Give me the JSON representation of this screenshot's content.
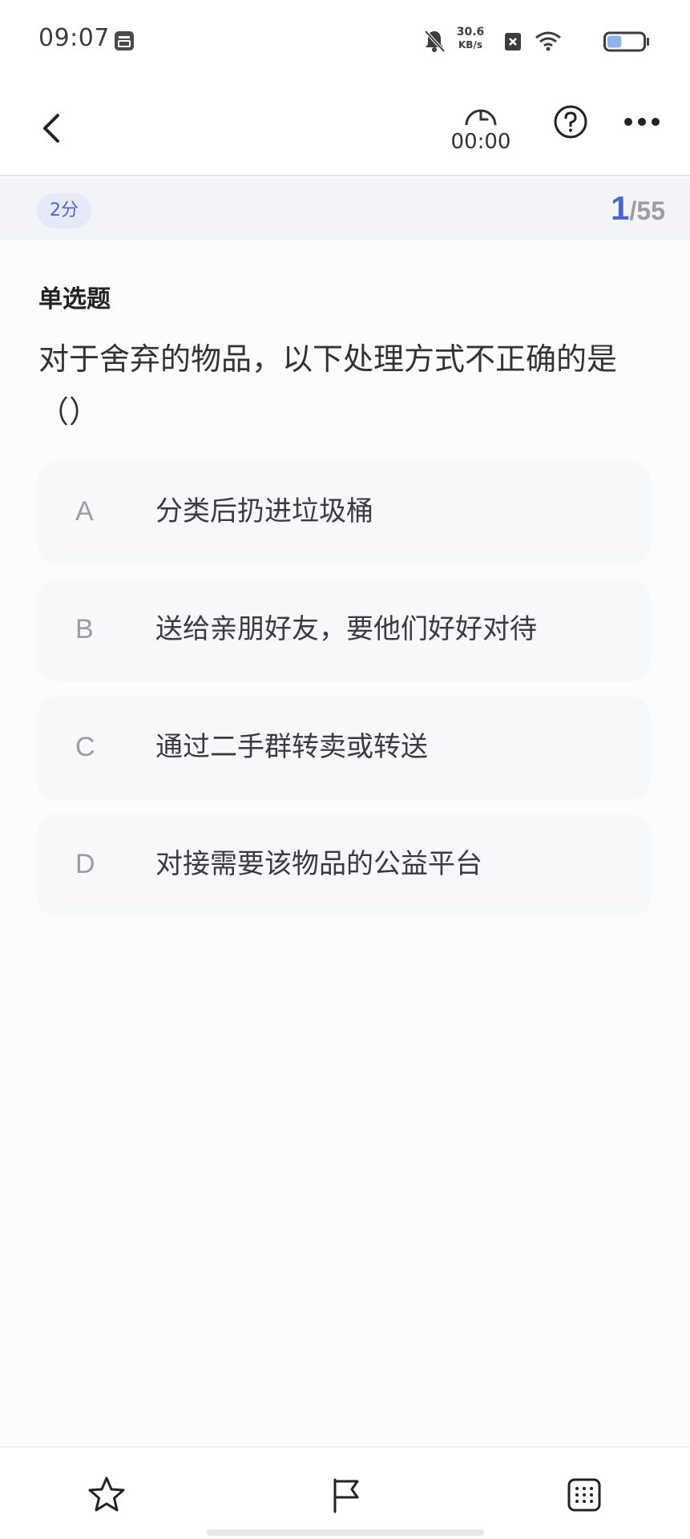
{
  "status_bar": {
    "time": "09:07",
    "net_speed_value": "30.6",
    "net_speed_unit": "KB/s",
    "battery_level": 0.4
  },
  "header": {
    "timer": "00:00",
    "icons": [
      "back-arrow-icon",
      "timer-icon",
      "help-icon",
      "more-icon"
    ]
  },
  "score": {
    "badge": "2分",
    "current": "1",
    "total": "/55"
  },
  "question": {
    "type": "单选题",
    "text": "对于舍弃的物品，以下处理方式不正确的是（）",
    "options": [
      {
        "letter": "A",
        "text": "分类后扔进垃圾桶"
      },
      {
        "letter": "B",
        "text": "送给亲朋好友，要他们好好对待"
      },
      {
        "letter": "C",
        "text": "通过二手群转卖或转送"
      },
      {
        "letter": "D",
        "text": "对接需要该物品的公益平台"
      }
    ]
  },
  "toolbar": {
    "icons": [
      "star-icon",
      "flag-icon",
      "answer-sheet-icon"
    ]
  },
  "colors": {
    "accent": "#4b66cc",
    "badge_bg": "#e6e9f8",
    "option_bg": "#f7f8fa"
  }
}
